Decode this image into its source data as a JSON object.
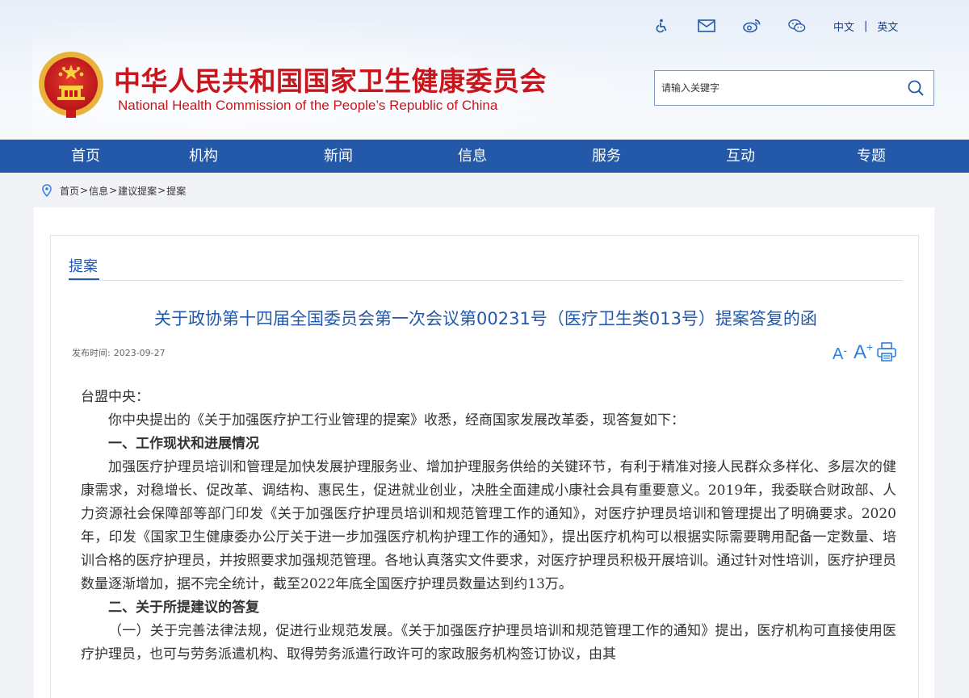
{
  "site": {
    "title_cn": "中华人民共和国国家卫生健康委员会",
    "title_en": "National Health Commission of the People’s Republic of China"
  },
  "toolbar": {
    "icons": [
      "accessibility-icon",
      "mail-icon",
      "weibo-icon",
      "wechat-icon"
    ],
    "lang_cn": "中文",
    "lang_sep": "|",
    "lang_en": "英文"
  },
  "search": {
    "placeholder": "请输入关键字"
  },
  "nav": {
    "items": [
      "首页",
      "机构",
      "新闻",
      "信息",
      "服务",
      "互动",
      "专题"
    ]
  },
  "breadcrumb": {
    "items": [
      "首页",
      "信息",
      "建议提案",
      "提案"
    ],
    "separator": ">"
  },
  "section": {
    "tab": "提案"
  },
  "article": {
    "title": "关于政协第十四届全国委员会第一次会议第00231号（医疗卫生类013号）提案答复的函",
    "pub_label": "发布时间:",
    "pub_date": "2023-09-27",
    "font_larger_1": "A",
    "font_larger_2": "A",
    "paragraphs": [
      "台盟中央：",
      "你中央提出的《关于加强医疗护工行业管理的提案》收悉，经商国家发展改革委，现答复如下：",
      "一、工作现状和进展情况",
      "加强医疗护理员培训和管理是加快发展护理服务业、增加护理服务供给的关键环节，有利于精准对接人民群众多样化、多层次的健康需求，对稳增长、促改革、调结构、惠民生，促进就业创业，决胜全面建成小康社会具有重要意义。2019年，我委联合财政部、人力资源社会保障部等部门印发《关于加强医疗护理员培训和规范管理工作的通知》，对医疗护理员培训和管理提出了明确要求。2020年，印发《国家卫生健康委办公厅关于进一步加强医疗机构护理工作的通知》，提出医疗机构可以根据实际需要聘用配备一定数量、培训合格的医疗护理员，并按照要求加强规范管理。各地认真落实文件要求，对医疗护理员积极开展培训。通过针对性培训，医疗护理员数量逐渐增加，据不完全统计，截至2022年底全国医疗护理员数量达到约13万。",
      "二、关于所提建议的答复",
      "（一）关于完善法律法规，促进行业规范发展。《关于加强医疗护理员培训和规范管理工作的通知》提出，医疗机构可直接使用医疗护理员，也可与劳务派遣机构、取得劳务派遣行政许可的家政服务机构签订协议，由其"
    ]
  },
  "colors": {
    "brand_red": "#c8161d",
    "nav_blue": "#2359a8",
    "link_blue": "#2f7fe0"
  }
}
